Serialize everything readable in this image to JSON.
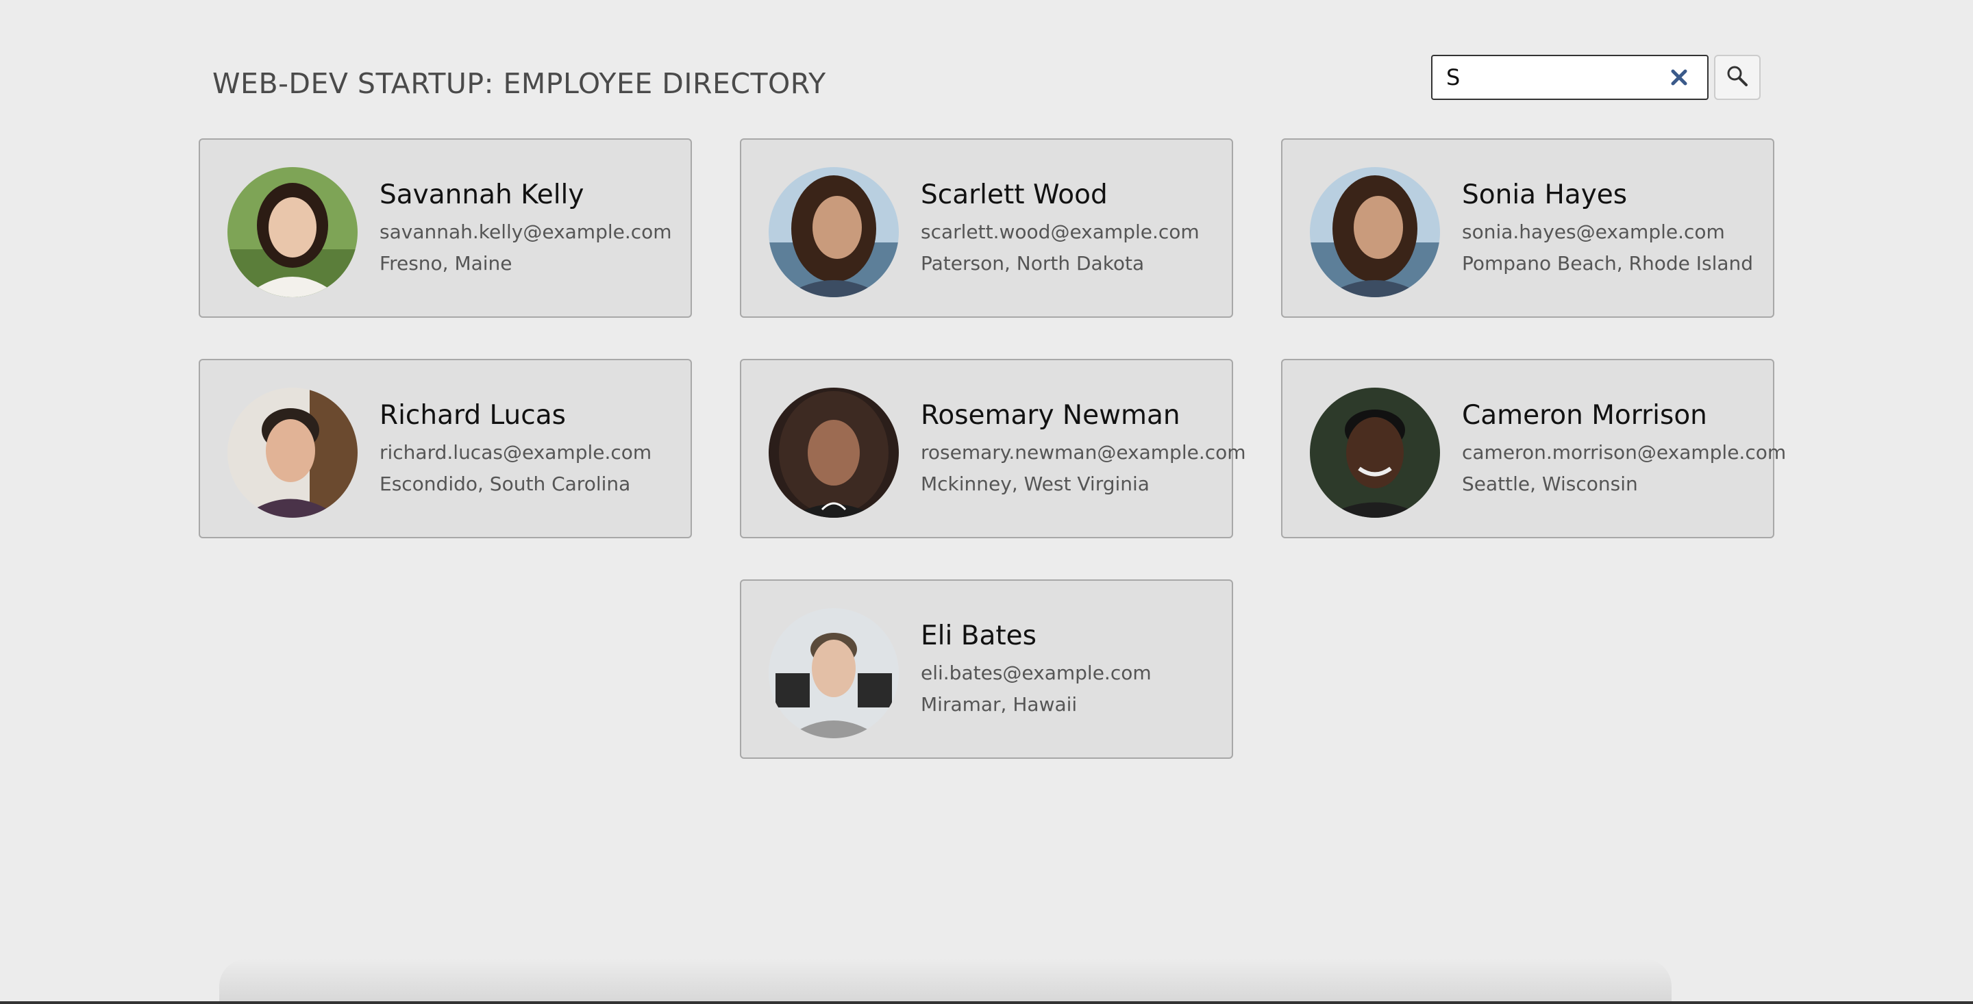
{
  "header": {
    "title": "WEB-DEV STARTUP: EMPLOYEE DIRECTORY"
  },
  "search": {
    "value": "S",
    "clear_icon": "close-icon",
    "button_icon": "search-icon"
  },
  "colors": {
    "card_background": "#e0e0e0",
    "card_border": "#a8a8a8",
    "clear_icon": "#3b5a8a"
  },
  "employees": [
    {
      "name": "Savannah Kelly",
      "email": "savannah.kelly@example.com",
      "location": "Fresno, Maine"
    },
    {
      "name": "Scarlett Wood",
      "email": "scarlett.wood@example.com",
      "location": "Paterson, North Dakota"
    },
    {
      "name": "Sonia Hayes",
      "email": "sonia.hayes@example.com",
      "location": "Pompano Beach, Rhode Island"
    },
    {
      "name": "Richard Lucas",
      "email": "richard.lucas@example.com",
      "location": "Escondido, South Carolina"
    },
    {
      "name": "Rosemary Newman",
      "email": "rosemary.newman@example.com",
      "location": "Mckinney, West Virginia"
    },
    {
      "name": "Cameron Morrison",
      "email": "cameron.morrison@example.com",
      "location": "Seattle, Wisconsin"
    },
    {
      "name": "Eli Bates",
      "email": "eli.bates@example.com",
      "location": "Miramar, Hawaii"
    }
  ]
}
